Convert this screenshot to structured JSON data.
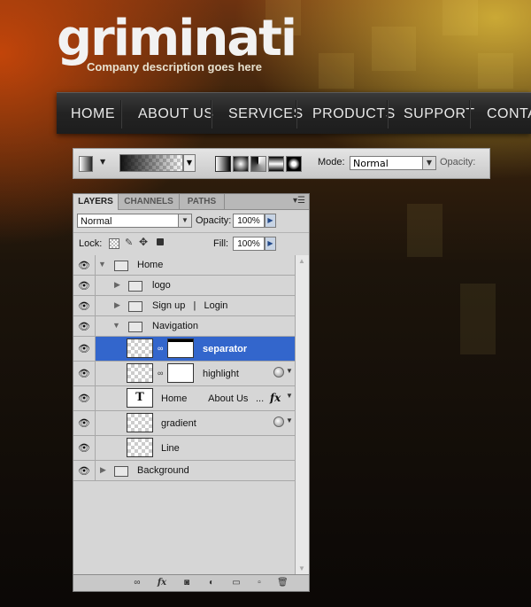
{
  "site": {
    "logo": "griminati",
    "tagline": "Company description goes here",
    "nav": [
      "HOME",
      "ABOUT US",
      "SERVICES",
      "PRODUCTS",
      "SUPPORT",
      "CONTACT"
    ]
  },
  "options_bar": {
    "mode_label": "Mode:",
    "mode_value": "Normal",
    "opacity_label": "Opacity:"
  },
  "layers_panel": {
    "tabs": [
      "LAYERS",
      "CHANNELS",
      "PATHS"
    ],
    "blend_mode": "Normal",
    "opacity_label": "Opacity:",
    "opacity_value": "100%",
    "lock_label": "Lock:",
    "fill_label": "Fill:",
    "fill_value": "100%",
    "layers": [
      {
        "name": "Home",
        "type": "group",
        "expanded": true
      },
      {
        "name": "logo",
        "type": "group",
        "expanded": false
      },
      {
        "name": "Sign up   |   Login",
        "type": "group",
        "expanded": false
      },
      {
        "name": "Navigation",
        "type": "group",
        "expanded": true
      },
      {
        "name": "separator",
        "type": "layer",
        "selected": true
      },
      {
        "name": "highlight",
        "type": "layer"
      },
      {
        "name": "Home        About Us",
        "type": "text"
      },
      {
        "name": "gradient",
        "type": "layer"
      },
      {
        "name": "Line",
        "type": "layer"
      },
      {
        "name": "Background",
        "type": "group",
        "expanded": false
      }
    ],
    "text_thumb": "T",
    "fx_label": "fx",
    "ellipsis": "..."
  },
  "colors": {
    "selection": "#3366cc"
  }
}
